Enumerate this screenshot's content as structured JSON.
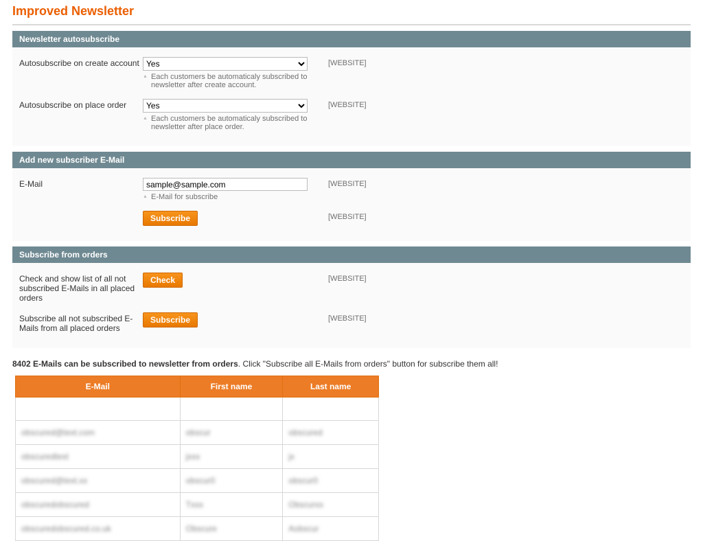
{
  "page": {
    "title": "Improved Newsletter"
  },
  "scope": {
    "website": "[WEBSITE]"
  },
  "sections": {
    "autosubscribe": {
      "title": "Newsletter autosubscribe",
      "fields": {
        "on_create": {
          "label": "Autosubscribe on create account",
          "value": "Yes",
          "hint": "Each customers be automaticaly subscribed to newsletter after create account."
        },
        "on_order": {
          "label": "Autosubscribe on place order",
          "value": "Yes",
          "hint": "Each customers be automaticaly subscribed to newsletter after place order."
        }
      }
    },
    "add_subscriber": {
      "title": "Add new subscriber E-Mail",
      "fields": {
        "email": {
          "label": "E-Mail",
          "value": "sample@sample.com",
          "hint": "E-Mail for subscribe"
        },
        "subscribe_btn": {
          "label": "Subscribe"
        }
      }
    },
    "from_orders": {
      "title": "Subscribe from orders",
      "fields": {
        "check": {
          "label": "Check and show list of all not subscribed E-Mails in all placed orders",
          "button": "Check"
        },
        "subscribe_all": {
          "label": "Subscribe all not subscribed E-Mails from all placed orders",
          "button": "Subscribe"
        }
      }
    }
  },
  "message": {
    "bold": "8402 E-Mails can be subscribed to newsletter from orders",
    "rest": ". Click \"Subscribe all E-Mails from orders\" button for subscribe them all!"
  },
  "table": {
    "headers": {
      "email": "E-Mail",
      "first": "First name",
      "last": "Last name"
    },
    "rows": [
      {
        "email": "",
        "first": "",
        "last": ""
      },
      {
        "email": "obscured@text.com",
        "first": "obscur",
        "last": "obscured"
      },
      {
        "email": "obscuredtext",
        "first": "jxxx",
        "last": "jx"
      },
      {
        "email": "obscured@text.xx",
        "first": "obscur0",
        "last": "obscur0"
      },
      {
        "email": "obscuredobscured",
        "first": "Txxx",
        "last": "Obscurxx"
      },
      {
        "email": "obscuredobscured.co.uk",
        "first": "Obscure",
        "last": "Aobscur"
      }
    ]
  }
}
